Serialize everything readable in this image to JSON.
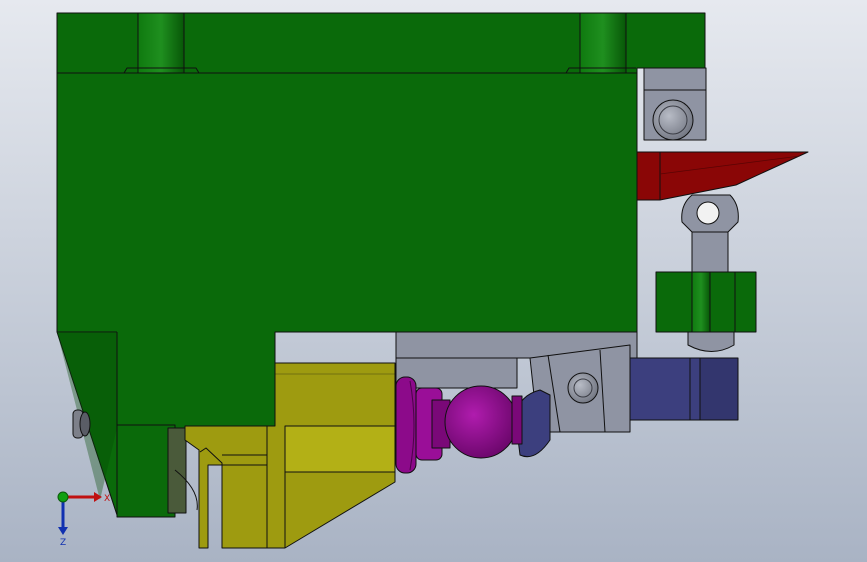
{
  "viewport": {
    "background_top": "#e6e9ef",
    "background_bottom": "#a9b3c4"
  },
  "colors": {
    "green_body": "#0a6a0a",
    "green_dark": "#064a06",
    "green_light": "#1f8a1f",
    "yellow_part": "#9e9b10",
    "yellow_dark": "#6e6c08",
    "grey_part": "#8f94a3",
    "grey_dark": "#5e6270",
    "red_part": "#8a0606",
    "purple_part": "#8c0a8a",
    "purple_dark": "#5a055a",
    "navy_part": "#3c3f7e",
    "navy_dark": "#23254f",
    "outline": "#101010"
  },
  "triad": {
    "x_label": "X",
    "z_label": "Z",
    "x_color": "#c01010",
    "z_color": "#1030b0",
    "y_color": "#10a010"
  }
}
